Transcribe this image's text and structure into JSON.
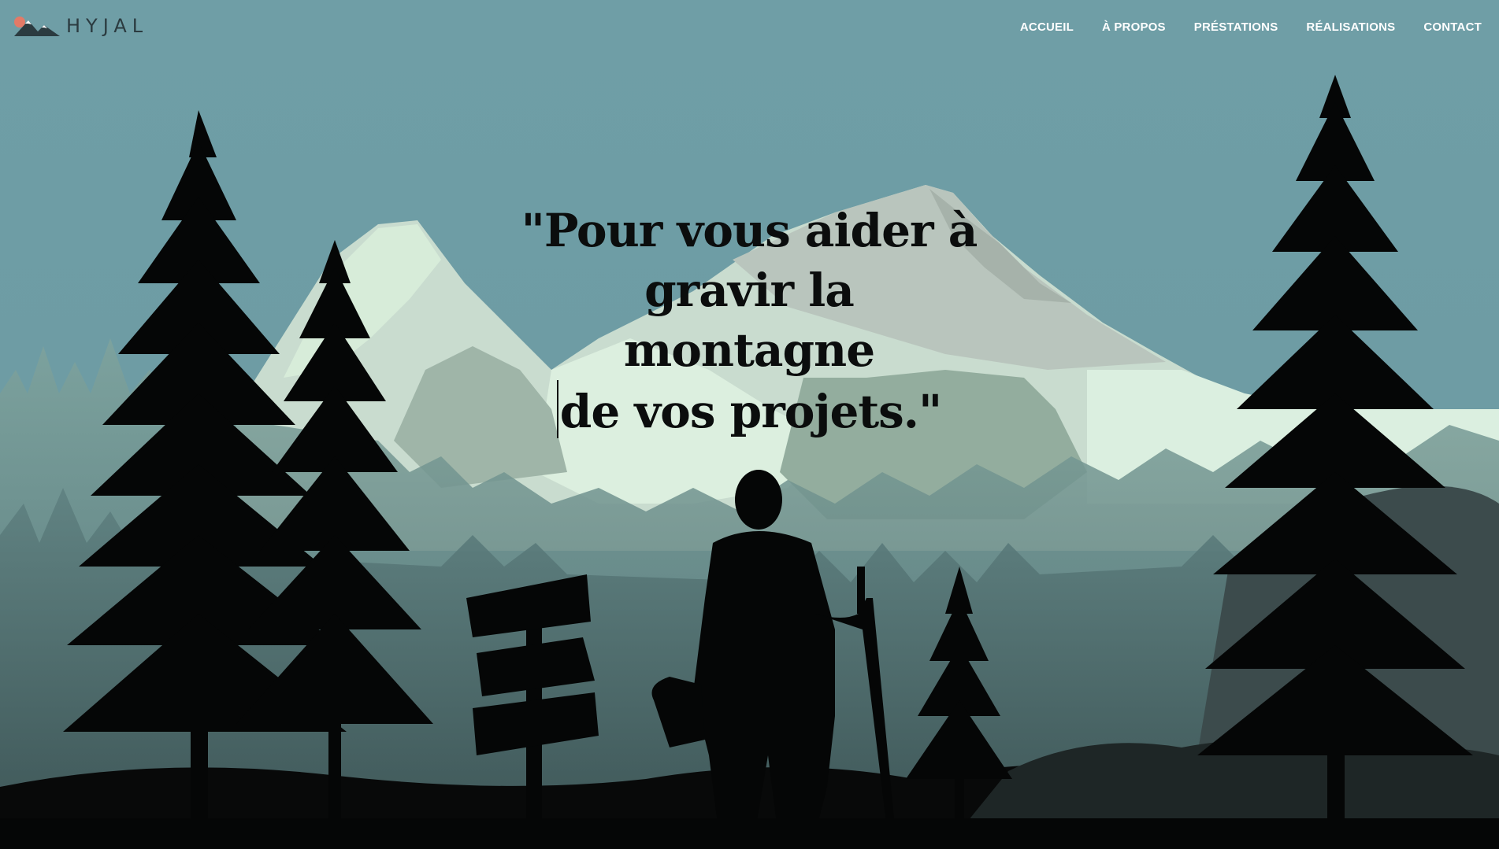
{
  "brand": {
    "name": "HYJAL",
    "logo_icon": "mountain-sun-logo-icon",
    "colors": {
      "sky": "#6f9ea6",
      "snow": "#d6ead8",
      "silhouette": "#050606",
      "text_dark": "#0b0d0d",
      "logo_sun": "#e37a67"
    }
  },
  "nav": {
    "items": [
      {
        "label": "ACCUEIL"
      },
      {
        "label": "À PROPOS"
      },
      {
        "label": "PRÉSTATIONS"
      },
      {
        "label": "RÉALISATIONS"
      },
      {
        "label": "CONTACT"
      }
    ]
  },
  "hero": {
    "headline_lines": [
      "\"Pour vous aider à",
      "gravir la montagne",
      "de vos projets.\""
    ],
    "illustration": "hiker-mountain-forest-illustration"
  }
}
